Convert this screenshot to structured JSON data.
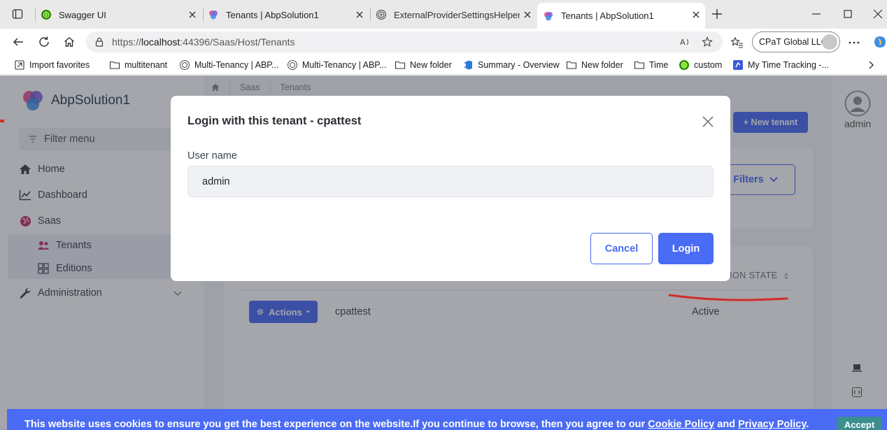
{
  "browser": {
    "tabs": [
      {
        "title": "Swagger UI",
        "active": false
      },
      {
        "title": "Tenants | AbpSolution1",
        "active": false
      },
      {
        "title": "ExternalProviderSettingsHelper af",
        "active": false
      },
      {
        "title": "Tenants | AbpSolution1",
        "active": true
      }
    ],
    "address": {
      "prefix": "https://",
      "host": "localhost",
      "rest": ":44396/Saas/Host/Tenants"
    },
    "profile_name": "CPaT Global LLC",
    "bookmarks": [
      "Import favorites",
      "multitenant",
      "Multi-Tenancy | ABP...",
      "Multi-Tenancy | ABP...",
      "New folder",
      "Summary - Overview",
      "New folder",
      "Time",
      "custom",
      "My Time Tracking -..."
    ]
  },
  "app": {
    "brand": "AbpSolution1",
    "filter_placeholder": "Filter menu",
    "menu": {
      "home": "Home",
      "dashboard": "Dashboard",
      "saas": "Saas",
      "tenants": "Tenants",
      "editions": "Editions",
      "administration": "Administration"
    },
    "breadcrumb": {
      "section": "Saas",
      "page": "Tenants"
    },
    "new_tenant_label": "+ New tenant",
    "filters_label": "Filters",
    "table": {
      "state_header": "ION STATE",
      "row": {
        "actions_label": "Actions",
        "name": "cpattest",
        "state": "Active"
      }
    },
    "user_name": "admin",
    "accent": "#4a6bf4"
  },
  "modal": {
    "title": "Login with this tenant - cpattest",
    "username_label": "User name",
    "username_value": "admin",
    "cancel_label": "Cancel",
    "login_label": "Login"
  },
  "cookie_banner": {
    "text_before": "This website uses cookies to ensure you get the best experience on the website.If you continue to browse, then you agree to our ",
    "cookie_policy": "Cookie Policy",
    "and": " and ",
    "privacy_policy": "Privacy Policy",
    "end": ".",
    "accept_label": "Accept"
  }
}
